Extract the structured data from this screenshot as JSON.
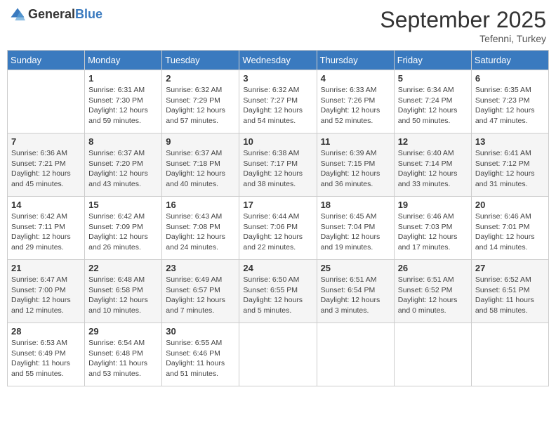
{
  "logo": {
    "general": "General",
    "blue": "Blue"
  },
  "header": {
    "month": "September 2025",
    "location": "Tefenni, Turkey"
  },
  "weekdays": [
    "Sunday",
    "Monday",
    "Tuesday",
    "Wednesday",
    "Thursday",
    "Friday",
    "Saturday"
  ],
  "weeks": [
    [
      {
        "day": "",
        "info": ""
      },
      {
        "day": "1",
        "info": "Sunrise: 6:31 AM\nSunset: 7:30 PM\nDaylight: 12 hours\nand 59 minutes."
      },
      {
        "day": "2",
        "info": "Sunrise: 6:32 AM\nSunset: 7:29 PM\nDaylight: 12 hours\nand 57 minutes."
      },
      {
        "day": "3",
        "info": "Sunrise: 6:32 AM\nSunset: 7:27 PM\nDaylight: 12 hours\nand 54 minutes."
      },
      {
        "day": "4",
        "info": "Sunrise: 6:33 AM\nSunset: 7:26 PM\nDaylight: 12 hours\nand 52 minutes."
      },
      {
        "day": "5",
        "info": "Sunrise: 6:34 AM\nSunset: 7:24 PM\nDaylight: 12 hours\nand 50 minutes."
      },
      {
        "day": "6",
        "info": "Sunrise: 6:35 AM\nSunset: 7:23 PM\nDaylight: 12 hours\nand 47 minutes."
      }
    ],
    [
      {
        "day": "7",
        "info": "Sunrise: 6:36 AM\nSunset: 7:21 PM\nDaylight: 12 hours\nand 45 minutes."
      },
      {
        "day": "8",
        "info": "Sunrise: 6:37 AM\nSunset: 7:20 PM\nDaylight: 12 hours\nand 43 minutes."
      },
      {
        "day": "9",
        "info": "Sunrise: 6:37 AM\nSunset: 7:18 PM\nDaylight: 12 hours\nand 40 minutes."
      },
      {
        "day": "10",
        "info": "Sunrise: 6:38 AM\nSunset: 7:17 PM\nDaylight: 12 hours\nand 38 minutes."
      },
      {
        "day": "11",
        "info": "Sunrise: 6:39 AM\nSunset: 7:15 PM\nDaylight: 12 hours\nand 36 minutes."
      },
      {
        "day": "12",
        "info": "Sunrise: 6:40 AM\nSunset: 7:14 PM\nDaylight: 12 hours\nand 33 minutes."
      },
      {
        "day": "13",
        "info": "Sunrise: 6:41 AM\nSunset: 7:12 PM\nDaylight: 12 hours\nand 31 minutes."
      }
    ],
    [
      {
        "day": "14",
        "info": "Sunrise: 6:42 AM\nSunset: 7:11 PM\nDaylight: 12 hours\nand 29 minutes."
      },
      {
        "day": "15",
        "info": "Sunrise: 6:42 AM\nSunset: 7:09 PM\nDaylight: 12 hours\nand 26 minutes."
      },
      {
        "day": "16",
        "info": "Sunrise: 6:43 AM\nSunset: 7:08 PM\nDaylight: 12 hours\nand 24 minutes."
      },
      {
        "day": "17",
        "info": "Sunrise: 6:44 AM\nSunset: 7:06 PM\nDaylight: 12 hours\nand 22 minutes."
      },
      {
        "day": "18",
        "info": "Sunrise: 6:45 AM\nSunset: 7:04 PM\nDaylight: 12 hours\nand 19 minutes."
      },
      {
        "day": "19",
        "info": "Sunrise: 6:46 AM\nSunset: 7:03 PM\nDaylight: 12 hours\nand 17 minutes."
      },
      {
        "day": "20",
        "info": "Sunrise: 6:46 AM\nSunset: 7:01 PM\nDaylight: 12 hours\nand 14 minutes."
      }
    ],
    [
      {
        "day": "21",
        "info": "Sunrise: 6:47 AM\nSunset: 7:00 PM\nDaylight: 12 hours\nand 12 minutes."
      },
      {
        "day": "22",
        "info": "Sunrise: 6:48 AM\nSunset: 6:58 PM\nDaylight: 12 hours\nand 10 minutes."
      },
      {
        "day": "23",
        "info": "Sunrise: 6:49 AM\nSunset: 6:57 PM\nDaylight: 12 hours\nand 7 minutes."
      },
      {
        "day": "24",
        "info": "Sunrise: 6:50 AM\nSunset: 6:55 PM\nDaylight: 12 hours\nand 5 minutes."
      },
      {
        "day": "25",
        "info": "Sunrise: 6:51 AM\nSunset: 6:54 PM\nDaylight: 12 hours\nand 3 minutes."
      },
      {
        "day": "26",
        "info": "Sunrise: 6:51 AM\nSunset: 6:52 PM\nDaylight: 12 hours\nand 0 minutes."
      },
      {
        "day": "27",
        "info": "Sunrise: 6:52 AM\nSunset: 6:51 PM\nDaylight: 11 hours\nand 58 minutes."
      }
    ],
    [
      {
        "day": "28",
        "info": "Sunrise: 6:53 AM\nSunset: 6:49 PM\nDaylight: 11 hours\nand 55 minutes."
      },
      {
        "day": "29",
        "info": "Sunrise: 6:54 AM\nSunset: 6:48 PM\nDaylight: 11 hours\nand 53 minutes."
      },
      {
        "day": "30",
        "info": "Sunrise: 6:55 AM\nSunset: 6:46 PM\nDaylight: 11 hours\nand 51 minutes."
      },
      {
        "day": "",
        "info": ""
      },
      {
        "day": "",
        "info": ""
      },
      {
        "day": "",
        "info": ""
      },
      {
        "day": "",
        "info": ""
      }
    ]
  ]
}
